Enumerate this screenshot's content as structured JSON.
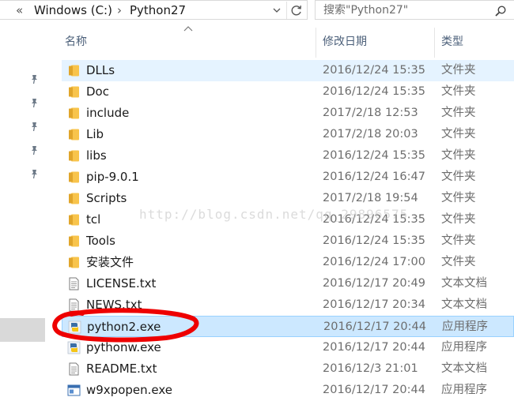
{
  "address_bar": {
    "overflow_chevron": "«",
    "separator": "›",
    "path": [
      "Windows (C:)",
      "Python27"
    ]
  },
  "search": {
    "placeholder": "搜索\"Python27\""
  },
  "columns": {
    "name": "名称",
    "modified": "修改日期",
    "type": "类型"
  },
  "files": [
    {
      "name": "DLLs",
      "modified": "2016/12/24 15:35",
      "type": "文件夹",
      "icon": "folder-icon"
    },
    {
      "name": "Doc",
      "modified": "2016/12/24 15:35",
      "type": "文件夹",
      "icon": "folder-icon"
    },
    {
      "name": "include",
      "modified": "2017/2/18 12:53",
      "type": "文件夹",
      "icon": "folder-icon"
    },
    {
      "name": "Lib",
      "modified": "2017/2/18 20:03",
      "type": "文件夹",
      "icon": "folder-icon"
    },
    {
      "name": "libs",
      "modified": "2016/12/24 15:35",
      "type": "文件夹",
      "icon": "folder-icon"
    },
    {
      "name": "pip-9.0.1",
      "modified": "2016/12/24 16:47",
      "type": "文件夹",
      "icon": "folder-icon"
    },
    {
      "name": "Scripts",
      "modified": "2017/2/18 19:54",
      "type": "文件夹",
      "icon": "folder-icon"
    },
    {
      "name": "tcl",
      "modified": "2016/12/24 15:35",
      "type": "文件夹",
      "icon": "folder-icon"
    },
    {
      "name": "Tools",
      "modified": "2016/12/24 15:35",
      "type": "文件夹",
      "icon": "folder-icon"
    },
    {
      "name": "安装文件",
      "modified": "2016/12/24 17:00",
      "type": "文件夹",
      "icon": "folder-icon"
    },
    {
      "name": "LICENSE.txt",
      "modified": "2016/12/17 20:49",
      "type": "文本文档",
      "icon": "text-file-icon"
    },
    {
      "name": "NEWS.txt",
      "modified": "2016/12/17 20:34",
      "type": "文本文档",
      "icon": "text-file-icon"
    },
    {
      "name": "python2.exe",
      "modified": "2016/12/17 20:44",
      "type": "应用程序",
      "icon": "python-app-icon"
    },
    {
      "name": "pythonw.exe",
      "modified": "2016/12/17 20:44",
      "type": "应用程序",
      "icon": "python-app-icon"
    },
    {
      "name": "README.txt",
      "modified": "2016/12/3 21:01",
      "type": "文本文档",
      "icon": "text-file-icon"
    },
    {
      "name": "w9xpopen.exe",
      "modified": "2016/12/17 20:44",
      "type": "应用程序",
      "icon": "window-app-icon"
    }
  ],
  "hovered_row": "DLLs",
  "selected_row": "python2.exe",
  "watermark": "http://blog.csdn.net/qq_29896575",
  "colors": {
    "hover": "#e5f3ff",
    "selection": "#cce8ff",
    "selection_border": "#99d1ff",
    "folder": "#f8c44c",
    "annotation": "#ee0000",
    "header_text": "#4c607a"
  }
}
